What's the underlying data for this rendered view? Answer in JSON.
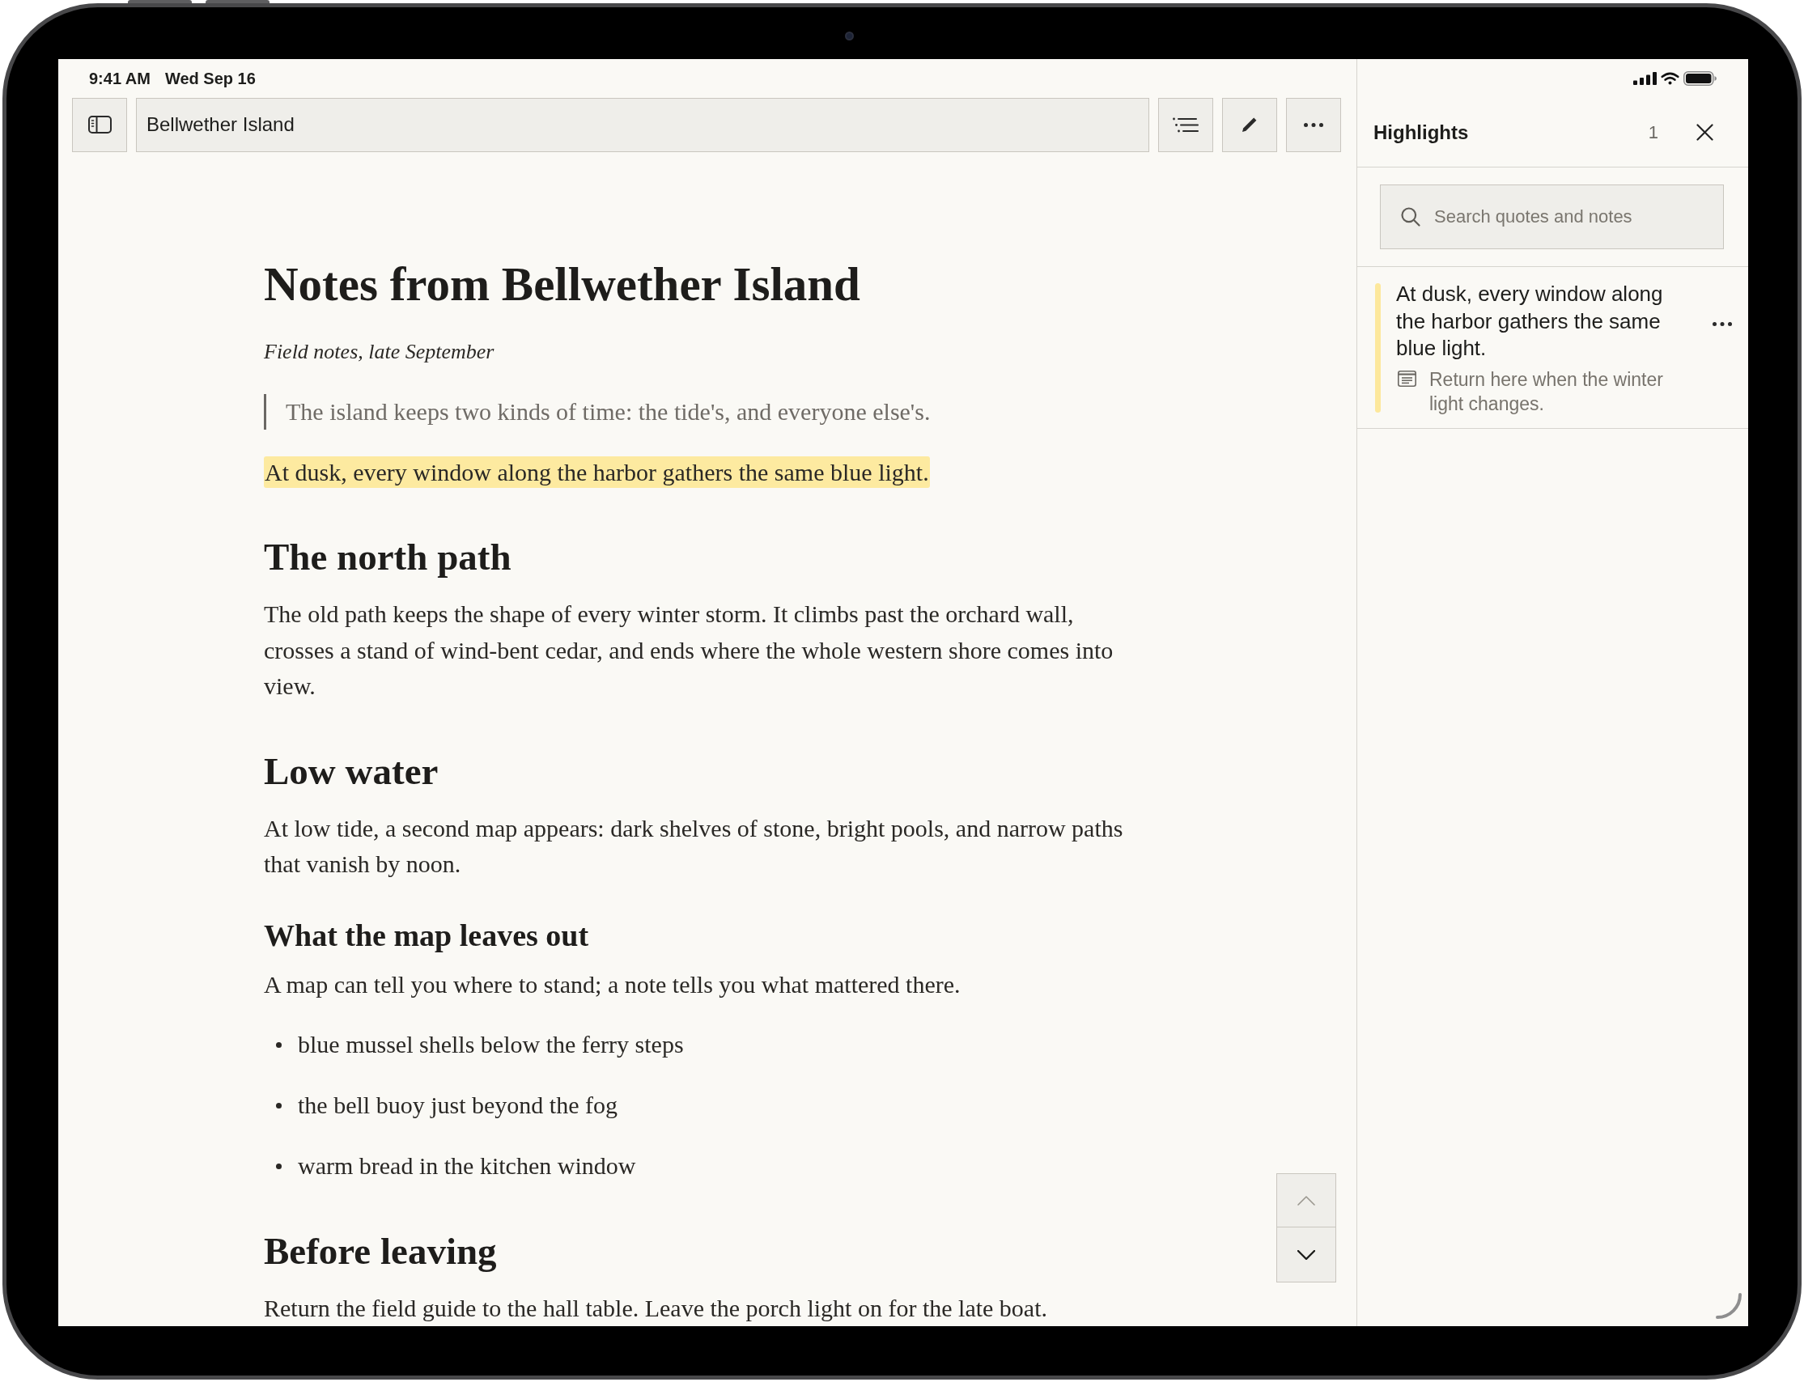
{
  "status_bar": {
    "time": "9:41 AM",
    "date": "Wed Sep 16"
  },
  "toolbar": {
    "title_field": {
      "value": "Bellwether Island"
    }
  },
  "document": {
    "title": "Notes from Bellwether Island",
    "subtitle": "Field notes, late September",
    "blocks": [
      {
        "kind": "quote",
        "text": "The island keeps two kinds of time: the tide's, and everyone else's."
      },
      {
        "kind": "paragraph",
        "text": "At dusk, every window along the harbor gathers the same blue light.",
        "highlighted": true
      },
      {
        "kind": "heading",
        "text": "The north path"
      },
      {
        "kind": "paragraph",
        "text": "The old path keeps the shape of every winter storm. It climbs past the orchard wall, crosses a stand of wind-bent cedar, and ends where the whole western shore comes into view.",
        "highlighted": false
      },
      {
        "kind": "heading",
        "text": "Low water"
      },
      {
        "kind": "paragraph",
        "text": "At low tide, a second map appears: dark shelves of stone, bright pools, and narrow paths that vanish by noon.",
        "highlighted": false
      },
      {
        "kind": "subheading",
        "text": "What the map leaves out"
      },
      {
        "kind": "paragraph",
        "text": "A map can tell you where to stand; a note tells you what mattered there.",
        "highlighted": false
      },
      {
        "kind": "bullets",
        "items": [
          "blue mussel shells below the ferry steps",
          "the bell buoy just beyond the fog",
          "warm bread in the kitchen window"
        ]
      },
      {
        "kind": "heading",
        "text": "Before leaving"
      },
      {
        "kind": "paragraph",
        "text": "Return the field guide to the hall table. Leave the porch light on for the late boat.",
        "highlighted": false
      }
    ]
  },
  "scroll_buttons": [
    {
      "kind": "up",
      "disabled": true
    },
    {
      "kind": "down",
      "disabled": false
    }
  ],
  "highlights_panel": {
    "title": "Highlights",
    "count": "1",
    "search": {
      "placeholder": "Search quotes and notes"
    },
    "items": [
      {
        "quote": "At dusk, every window along the harbor gathers the same blue light.",
        "note": "Return here when the winter light changes."
      }
    ]
  }
}
